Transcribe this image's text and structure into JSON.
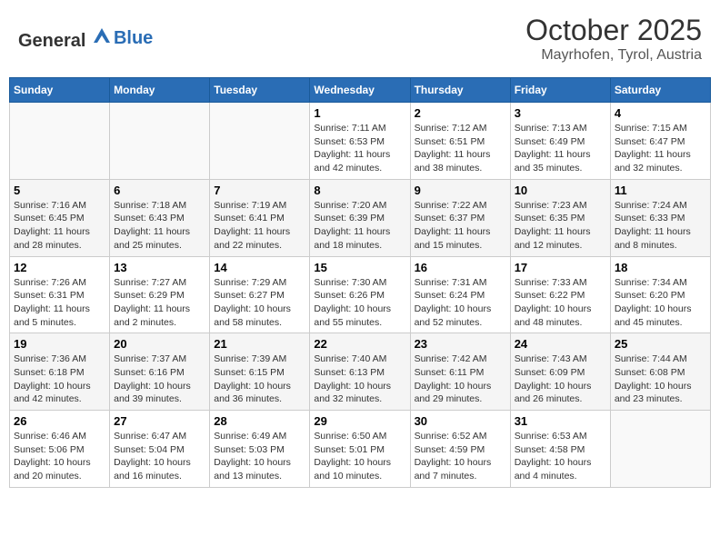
{
  "header": {
    "logo_general": "General",
    "logo_blue": "Blue",
    "month": "October 2025",
    "location": "Mayrhofen, Tyrol, Austria"
  },
  "weekdays": [
    "Sunday",
    "Monday",
    "Tuesday",
    "Wednesday",
    "Thursday",
    "Friday",
    "Saturday"
  ],
  "weeks": [
    [
      {
        "day": "",
        "sunrise": "",
        "sunset": "",
        "daylight": ""
      },
      {
        "day": "",
        "sunrise": "",
        "sunset": "",
        "daylight": ""
      },
      {
        "day": "",
        "sunrise": "",
        "sunset": "",
        "daylight": ""
      },
      {
        "day": "1",
        "sunrise": "Sunrise: 7:11 AM",
        "sunset": "Sunset: 6:53 PM",
        "daylight": "Daylight: 11 hours and 42 minutes."
      },
      {
        "day": "2",
        "sunrise": "Sunrise: 7:12 AM",
        "sunset": "Sunset: 6:51 PM",
        "daylight": "Daylight: 11 hours and 38 minutes."
      },
      {
        "day": "3",
        "sunrise": "Sunrise: 7:13 AM",
        "sunset": "Sunset: 6:49 PM",
        "daylight": "Daylight: 11 hours and 35 minutes."
      },
      {
        "day": "4",
        "sunrise": "Sunrise: 7:15 AM",
        "sunset": "Sunset: 6:47 PM",
        "daylight": "Daylight: 11 hours and 32 minutes."
      }
    ],
    [
      {
        "day": "5",
        "sunrise": "Sunrise: 7:16 AM",
        "sunset": "Sunset: 6:45 PM",
        "daylight": "Daylight: 11 hours and 28 minutes."
      },
      {
        "day": "6",
        "sunrise": "Sunrise: 7:18 AM",
        "sunset": "Sunset: 6:43 PM",
        "daylight": "Daylight: 11 hours and 25 minutes."
      },
      {
        "day": "7",
        "sunrise": "Sunrise: 7:19 AM",
        "sunset": "Sunset: 6:41 PM",
        "daylight": "Daylight: 11 hours and 22 minutes."
      },
      {
        "day": "8",
        "sunrise": "Sunrise: 7:20 AM",
        "sunset": "Sunset: 6:39 PM",
        "daylight": "Daylight: 11 hours and 18 minutes."
      },
      {
        "day": "9",
        "sunrise": "Sunrise: 7:22 AM",
        "sunset": "Sunset: 6:37 PM",
        "daylight": "Daylight: 11 hours and 15 minutes."
      },
      {
        "day": "10",
        "sunrise": "Sunrise: 7:23 AM",
        "sunset": "Sunset: 6:35 PM",
        "daylight": "Daylight: 11 hours and 12 minutes."
      },
      {
        "day": "11",
        "sunrise": "Sunrise: 7:24 AM",
        "sunset": "Sunset: 6:33 PM",
        "daylight": "Daylight: 11 hours and 8 minutes."
      }
    ],
    [
      {
        "day": "12",
        "sunrise": "Sunrise: 7:26 AM",
        "sunset": "Sunset: 6:31 PM",
        "daylight": "Daylight: 11 hours and 5 minutes."
      },
      {
        "day": "13",
        "sunrise": "Sunrise: 7:27 AM",
        "sunset": "Sunset: 6:29 PM",
        "daylight": "Daylight: 11 hours and 2 minutes."
      },
      {
        "day": "14",
        "sunrise": "Sunrise: 7:29 AM",
        "sunset": "Sunset: 6:27 PM",
        "daylight": "Daylight: 10 hours and 58 minutes."
      },
      {
        "day": "15",
        "sunrise": "Sunrise: 7:30 AM",
        "sunset": "Sunset: 6:26 PM",
        "daylight": "Daylight: 10 hours and 55 minutes."
      },
      {
        "day": "16",
        "sunrise": "Sunrise: 7:31 AM",
        "sunset": "Sunset: 6:24 PM",
        "daylight": "Daylight: 10 hours and 52 minutes."
      },
      {
        "day": "17",
        "sunrise": "Sunrise: 7:33 AM",
        "sunset": "Sunset: 6:22 PM",
        "daylight": "Daylight: 10 hours and 48 minutes."
      },
      {
        "day": "18",
        "sunrise": "Sunrise: 7:34 AM",
        "sunset": "Sunset: 6:20 PM",
        "daylight": "Daylight: 10 hours and 45 minutes."
      }
    ],
    [
      {
        "day": "19",
        "sunrise": "Sunrise: 7:36 AM",
        "sunset": "Sunset: 6:18 PM",
        "daylight": "Daylight: 10 hours and 42 minutes."
      },
      {
        "day": "20",
        "sunrise": "Sunrise: 7:37 AM",
        "sunset": "Sunset: 6:16 PM",
        "daylight": "Daylight: 10 hours and 39 minutes."
      },
      {
        "day": "21",
        "sunrise": "Sunrise: 7:39 AM",
        "sunset": "Sunset: 6:15 PM",
        "daylight": "Daylight: 10 hours and 36 minutes."
      },
      {
        "day": "22",
        "sunrise": "Sunrise: 7:40 AM",
        "sunset": "Sunset: 6:13 PM",
        "daylight": "Daylight: 10 hours and 32 minutes."
      },
      {
        "day": "23",
        "sunrise": "Sunrise: 7:42 AM",
        "sunset": "Sunset: 6:11 PM",
        "daylight": "Daylight: 10 hours and 29 minutes."
      },
      {
        "day": "24",
        "sunrise": "Sunrise: 7:43 AM",
        "sunset": "Sunset: 6:09 PM",
        "daylight": "Daylight: 10 hours and 26 minutes."
      },
      {
        "day": "25",
        "sunrise": "Sunrise: 7:44 AM",
        "sunset": "Sunset: 6:08 PM",
        "daylight": "Daylight: 10 hours and 23 minutes."
      }
    ],
    [
      {
        "day": "26",
        "sunrise": "Sunrise: 6:46 AM",
        "sunset": "Sunset: 5:06 PM",
        "daylight": "Daylight: 10 hours and 20 minutes."
      },
      {
        "day": "27",
        "sunrise": "Sunrise: 6:47 AM",
        "sunset": "Sunset: 5:04 PM",
        "daylight": "Daylight: 10 hours and 16 minutes."
      },
      {
        "day": "28",
        "sunrise": "Sunrise: 6:49 AM",
        "sunset": "Sunset: 5:03 PM",
        "daylight": "Daylight: 10 hours and 13 minutes."
      },
      {
        "day": "29",
        "sunrise": "Sunrise: 6:50 AM",
        "sunset": "Sunset: 5:01 PM",
        "daylight": "Daylight: 10 hours and 10 minutes."
      },
      {
        "day": "30",
        "sunrise": "Sunrise: 6:52 AM",
        "sunset": "Sunset: 4:59 PM",
        "daylight": "Daylight: 10 hours and 7 minutes."
      },
      {
        "day": "31",
        "sunrise": "Sunrise: 6:53 AM",
        "sunset": "Sunset: 4:58 PM",
        "daylight": "Daylight: 10 hours and 4 minutes."
      },
      {
        "day": "",
        "sunrise": "",
        "sunset": "",
        "daylight": ""
      }
    ]
  ]
}
